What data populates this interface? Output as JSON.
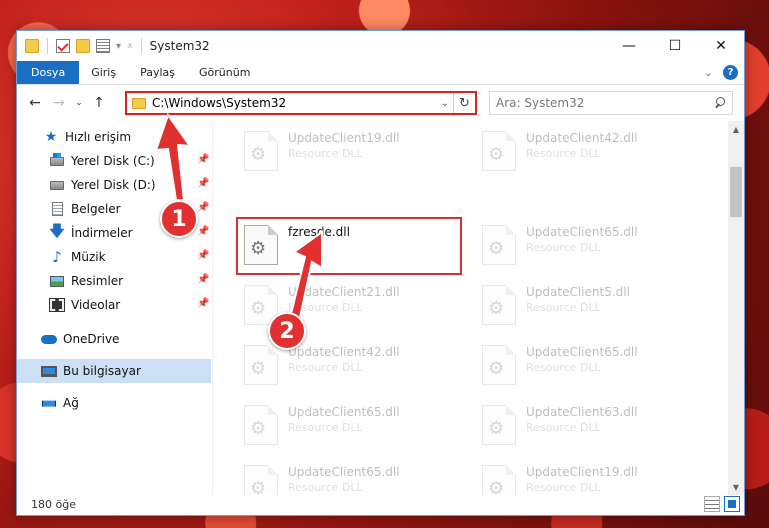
{
  "window": {
    "title": "System32",
    "controls": {
      "minimize": "—",
      "maximize": "☐",
      "close": "✕"
    }
  },
  "ribbon": {
    "tabs": [
      {
        "label": "Dosya"
      },
      {
        "label": "Giriş"
      },
      {
        "label": "Paylaş"
      },
      {
        "label": "Görünüm"
      }
    ],
    "help": "?"
  },
  "nav": {
    "address": "C:\\Windows\\System32",
    "search_placeholder": "Ara: System32"
  },
  "sidebar": {
    "items": [
      {
        "label": "Hızlı erişim",
        "icon": "star-icon"
      },
      {
        "label": "Yerel Disk (C:)",
        "icon": "drive-c-icon",
        "pinned": true
      },
      {
        "label": "Yerel Disk (D:)",
        "icon": "drive-d-icon",
        "pinned": true
      },
      {
        "label": "Belgeler",
        "icon": "documents-icon",
        "pinned": true
      },
      {
        "label": "İndirmeler",
        "icon": "downloads-icon",
        "pinned": true
      },
      {
        "label": "Müzik",
        "icon": "music-icon",
        "pinned": true
      },
      {
        "label": "Resimler",
        "icon": "pictures-icon",
        "pinned": true
      },
      {
        "label": "Videolar",
        "icon": "videos-icon",
        "pinned": true
      },
      {
        "label": "OneDrive",
        "icon": "onedrive-icon"
      },
      {
        "label": "Bu bilgisayar",
        "icon": "this-pc-icon",
        "selected": true
      },
      {
        "label": "Ağ",
        "icon": "network-icon"
      }
    ]
  },
  "files": {
    "col1": [
      {
        "name": "UpdateClient19.dll",
        "type": "Resource DLL"
      },
      {
        "name": "fzresde.dll",
        "type": ""
      },
      {
        "name": "UpdateClient21.dll",
        "type": "Resource DLL"
      },
      {
        "name": "UpdateClient42.dll",
        "type": "Resource DLL"
      },
      {
        "name": "UpdateClient65.dll",
        "type": "Resource DLL"
      },
      {
        "name": "UpdateClient65.dll",
        "type": "Resource DLL"
      }
    ],
    "col2": [
      {
        "name": "UpdateClient42.dll",
        "type": "Resource DLL"
      },
      {
        "name": "UpdateClient65.dll",
        "type": "Resource DLL"
      },
      {
        "name": "UpdateClient5.dll",
        "type": "Resource DLL"
      },
      {
        "name": "UpdateClient65.dll",
        "type": "Resource DLL"
      },
      {
        "name": "UpdateClient63.dll",
        "type": "Resource DLL"
      },
      {
        "name": "UpdateClient19.dll",
        "type": "Resource DLL"
      }
    ]
  },
  "status": {
    "count": "180 öğe"
  },
  "annotations": {
    "step1": "1",
    "step2": "2",
    "color": "#e03030"
  },
  "colors": {
    "accent": "#1a6fc4",
    "highlight": "#e02020"
  }
}
